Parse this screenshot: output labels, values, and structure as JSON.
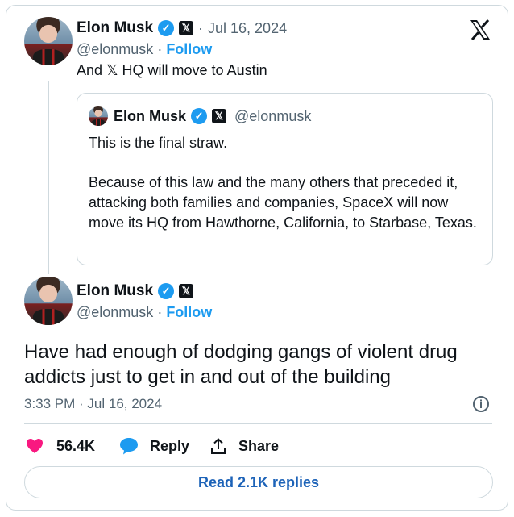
{
  "tweet": {
    "author_name": "Elon Musk",
    "handle": "@elonmusk",
    "date": "Jul 16, 2024",
    "dot": "·",
    "follow_label": "Follow",
    "text": "And 𝕏 HQ will move to Austin"
  },
  "quoted": {
    "author_name": "Elon Musk",
    "handle": "@elonmusk",
    "line1": "This is the final straw.",
    "paragraph": "Because of this law and the many others that preceded it, attacking both families and companies, SpaceX will now move its HQ from Hawthorne, California, to Starbase, Texas."
  },
  "reply": {
    "author_name": "Elon Musk",
    "handle": "@elonmusk",
    "dot": "·",
    "follow_label": "Follow",
    "text": "Have had enough of dodging gangs of violent drug addicts just to get in and out of the building",
    "timestamp": "3:33 PM · Jul 16, 2024"
  },
  "actions": {
    "likes": "56.4K",
    "reply_label": "Reply",
    "share_label": "Share"
  },
  "read_replies_label": "Read 2.1K replies",
  "icons": {
    "verified": "verified-badge-icon",
    "x_logo": "x-logo-icon",
    "info": "info-icon",
    "heart": "heart-icon",
    "reply": "reply-bubble-icon",
    "share": "share-icon"
  },
  "colors": {
    "accent": "#1d9bf0",
    "like": "#f91880",
    "text": "#0f1419",
    "muted": "#536471",
    "border": "#cfd9de"
  }
}
